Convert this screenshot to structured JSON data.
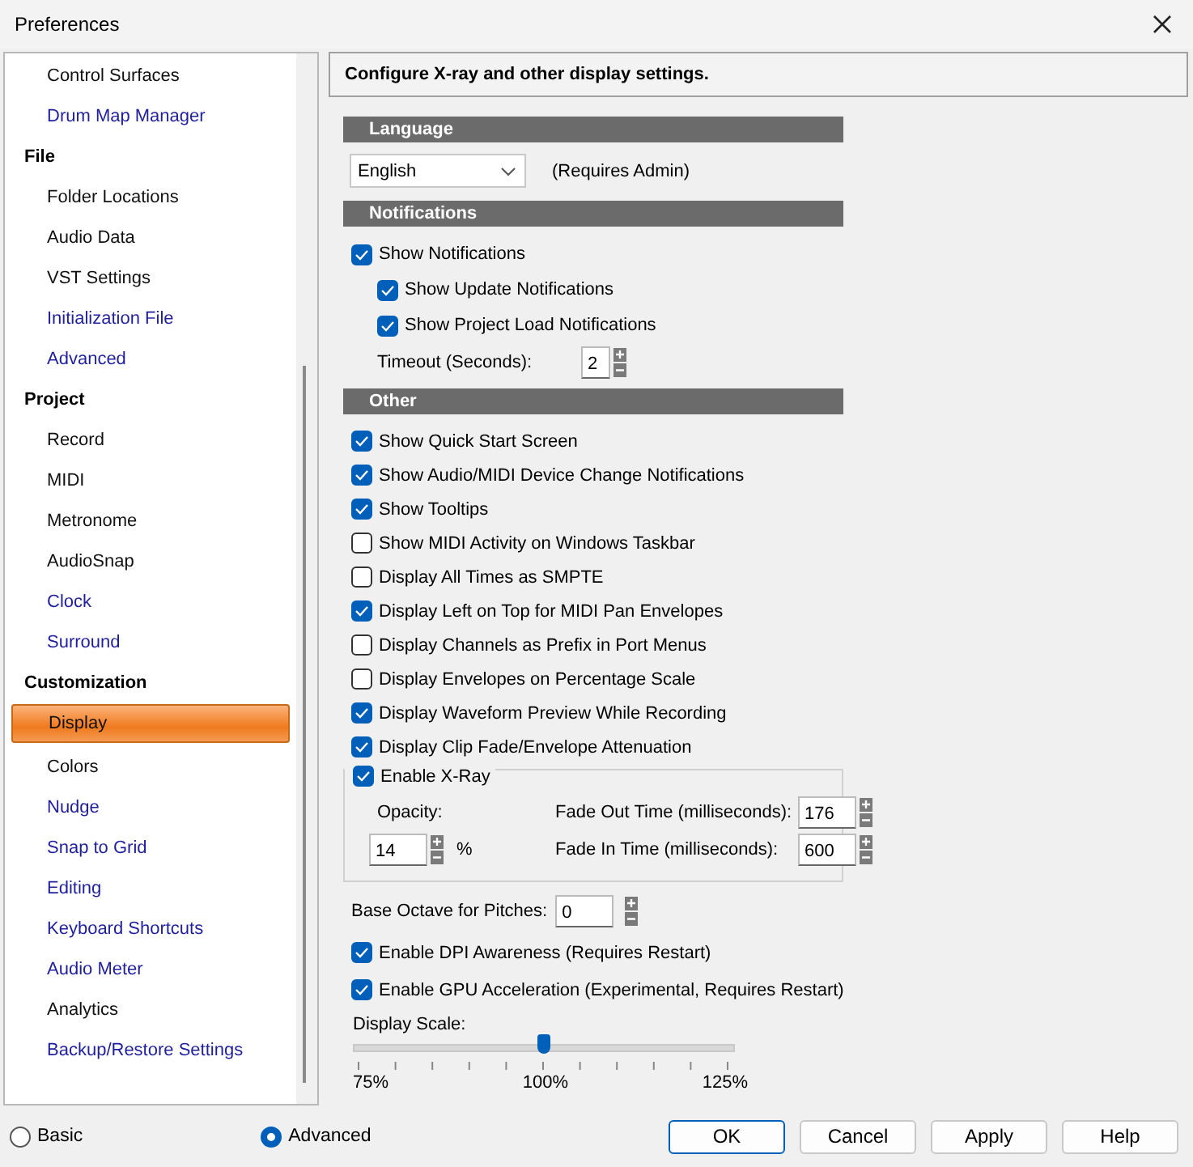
{
  "window": {
    "title": "Preferences"
  },
  "sidebar": {
    "groups": [
      {
        "items": [
          {
            "label": "Control Surfaces",
            "visited": false,
            "selected": false
          },
          {
            "label": "Drum Map Manager",
            "visited": true,
            "selected": false
          }
        ]
      },
      {
        "heading": "File",
        "items": [
          {
            "label": "Folder Locations",
            "visited": false,
            "selected": false
          },
          {
            "label": "Audio Data",
            "visited": false,
            "selected": false
          },
          {
            "label": "VST Settings",
            "visited": false,
            "selected": false
          },
          {
            "label": "Initialization File",
            "visited": true,
            "selected": false
          },
          {
            "label": "Advanced",
            "visited": true,
            "selected": false
          }
        ]
      },
      {
        "heading": "Project",
        "items": [
          {
            "label": "Record",
            "visited": false,
            "selected": false
          },
          {
            "label": "MIDI",
            "visited": false,
            "selected": false
          },
          {
            "label": "Metronome",
            "visited": false,
            "selected": false
          },
          {
            "label": "AudioSnap",
            "visited": false,
            "selected": false
          },
          {
            "label": "Clock",
            "visited": true,
            "selected": false
          },
          {
            "label": "Surround",
            "visited": true,
            "selected": false
          }
        ]
      },
      {
        "heading": "Customization",
        "items": [
          {
            "label": "Display",
            "visited": false,
            "selected": true
          },
          {
            "label": "Colors",
            "visited": false,
            "selected": false
          },
          {
            "label": "Nudge",
            "visited": true,
            "selected": false
          },
          {
            "label": "Snap to Grid",
            "visited": true,
            "selected": false
          },
          {
            "label": "Editing",
            "visited": true,
            "selected": false
          },
          {
            "label": "Keyboard Shortcuts",
            "visited": true,
            "selected": false
          },
          {
            "label": "Audio Meter",
            "visited": true,
            "selected": false
          },
          {
            "label": "Analytics",
            "visited": false,
            "selected": false
          },
          {
            "label": "Backup/Restore Settings",
            "visited": true,
            "selected": false
          }
        ]
      }
    ]
  },
  "content": {
    "header": "Configure X-ray and other display settings.",
    "language": {
      "heading": "Language",
      "dropdown": {
        "value": "English"
      },
      "note": "(Requires Admin)"
    },
    "notifications": {
      "heading": "Notifications",
      "options": [
        {
          "label": "Show Notifications",
          "checked": true,
          "children": [
            {
              "label": "Show Update Notifications",
              "checked": true
            },
            {
              "label": "Show Project Load Notifications",
              "checked": true
            }
          ]
        }
      ],
      "timeout": {
        "label": "Timeout (Seconds):",
        "value": "2"
      }
    },
    "other": {
      "heading": "Other",
      "options": [
        {
          "label": "Show Quick Start Screen",
          "checked": true
        },
        {
          "label": "Show Audio/MIDI Device Change Notifications",
          "checked": true
        },
        {
          "label": "Show Tooltips",
          "checked": true
        },
        {
          "label": "Show MIDI Activity on Windows Taskbar",
          "checked": false
        },
        {
          "label": "Display All Times as SMPTE",
          "checked": false
        },
        {
          "label": "Display Left on Top for MIDI Pan Envelopes",
          "checked": true
        },
        {
          "label": "Display Channels as Prefix in Port Menus",
          "checked": false
        },
        {
          "label": "Display Envelopes on Percentage Scale",
          "checked": false
        },
        {
          "label": "Display Waveform Preview While Recording",
          "checked": true
        },
        {
          "label": "Display Clip Fade/Envelope Attenuation",
          "checked": true
        }
      ],
      "xray": {
        "label": "Enable X-Ray",
        "checked": true,
        "opacity_label": "Opacity:",
        "opacity_value": "14",
        "opacity_unit": "%",
        "fade_out_label": "Fade Out Time (milliseconds):",
        "fade_out_value": "176",
        "fade_in_label": "Fade In Time (milliseconds):",
        "fade_in_value": "600"
      },
      "base_octave": {
        "label": "Base Octave for Pitches:",
        "value": "0"
      },
      "more_options": [
        {
          "label": "Enable DPI Awareness (Requires Restart)",
          "checked": true
        },
        {
          "label": "Enable GPU Acceleration (Experimental, Requires Restart)",
          "checked": true
        }
      ],
      "display_scale": {
        "label": "Display Scale:",
        "level": 0.5,
        "tick_labels": [
          "75%",
          "100%",
          "125%"
        ]
      }
    }
  },
  "footer": {
    "modes": [
      {
        "label": "Basic",
        "selected": false
      },
      {
        "label": "Advanced",
        "selected": true
      }
    ],
    "buttons": [
      {
        "label": "OK",
        "default": true
      },
      {
        "label": "Cancel",
        "default": false
      },
      {
        "label": "Apply",
        "default": false
      },
      {
        "label": "Help",
        "default": false
      }
    ]
  }
}
